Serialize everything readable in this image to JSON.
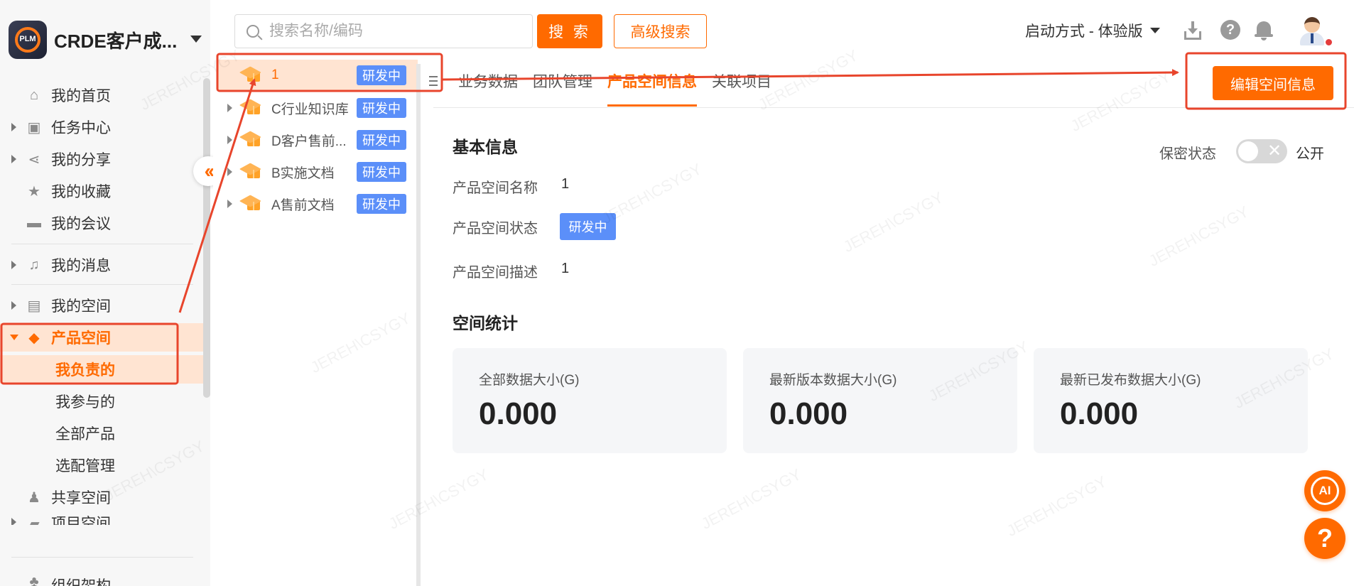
{
  "app": {
    "brand_name": "CRDE客户成...",
    "logo_text": "PLM"
  },
  "search": {
    "placeholder": "搜索名称/编码",
    "value": "",
    "search_label": "搜 索",
    "advanced_label": "高级搜索"
  },
  "topbar": {
    "launch_mode": "启动方式 - 体验版"
  },
  "sidebar": {
    "items": [
      {
        "label": "我的首页",
        "icon": "home-icon"
      },
      {
        "label": "任务中心",
        "icon": "clipboard-icon"
      },
      {
        "label": "我的分享",
        "icon": "share-icon"
      },
      {
        "label": "我的收藏",
        "icon": "star-icon"
      },
      {
        "label": "我的会议",
        "icon": "video-icon"
      },
      {
        "label": "我的消息",
        "icon": "bell-icon"
      },
      {
        "label": "我的空间",
        "icon": "archive-icon"
      },
      {
        "label": "产品空间",
        "icon": "cube-icon"
      },
      {
        "label": "我负责的"
      },
      {
        "label": "我参与的"
      },
      {
        "label": "全部产品"
      },
      {
        "label": "选配管理"
      },
      {
        "label": "共享空间",
        "icon": "people-icon"
      },
      {
        "label": "项目空间",
        "icon": "folder-icon"
      },
      {
        "label": "组织架构",
        "icon": "org-icon"
      }
    ]
  },
  "tree": {
    "items": [
      {
        "label": "1",
        "badge": "研发中"
      },
      {
        "label": "C行业知识库",
        "badge": "研发中"
      },
      {
        "label": "D客户售前...",
        "badge": "研发中"
      },
      {
        "label": "B实施文档",
        "badge": "研发中"
      },
      {
        "label": "A售前文档",
        "badge": "研发中"
      }
    ]
  },
  "tabs": [
    {
      "label": "业务数据"
    },
    {
      "label": "团队管理"
    },
    {
      "label": "产品空间信息"
    },
    {
      "label": "关联项目"
    }
  ],
  "main": {
    "edit_button": "编辑空间信息",
    "basic_title": "基本信息",
    "secret_label": "保密状态",
    "public_label": "公开",
    "fields": {
      "name_label": "产品空间名称",
      "name_value": "1",
      "status_label": "产品空间状态",
      "status_value": "研发中",
      "desc_label": "产品空间描述",
      "desc_value": "1"
    },
    "stats_title": "空间统计",
    "stats": [
      {
        "label": "全部数据大小(G)",
        "value": "0.000"
      },
      {
        "label": "最新版本数据大小(G)",
        "value": "0.000"
      },
      {
        "label": "最新已发布数据大小(G)",
        "value": "0.000"
      }
    ]
  },
  "floating": {
    "ai_label": "AI",
    "help_label": "?"
  },
  "watermark": "JEREH\\CSYGY",
  "colors": {
    "accent": "#ff6a00",
    "badge": "#5b8ff9",
    "annotation": "#e8452c"
  }
}
